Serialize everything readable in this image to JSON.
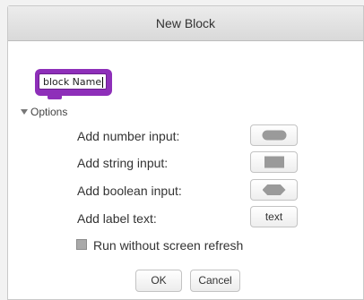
{
  "dialog": {
    "title": "New Block",
    "block_name": "block Name",
    "block_color": "#8e2fb9",
    "options_label": "Options",
    "inputs": [
      {
        "label": "Add number input:",
        "icon": "oval-shape-icon"
      },
      {
        "label": "Add string input:",
        "icon": "rectangle-shape-icon"
      },
      {
        "label": "Add boolean input:",
        "icon": "hexagon-shape-icon"
      },
      {
        "label": "Add label text:",
        "button_text": "text"
      }
    ],
    "refresh_label": "Run without screen refresh",
    "ok_label": "OK",
    "cancel_label": "Cancel"
  }
}
